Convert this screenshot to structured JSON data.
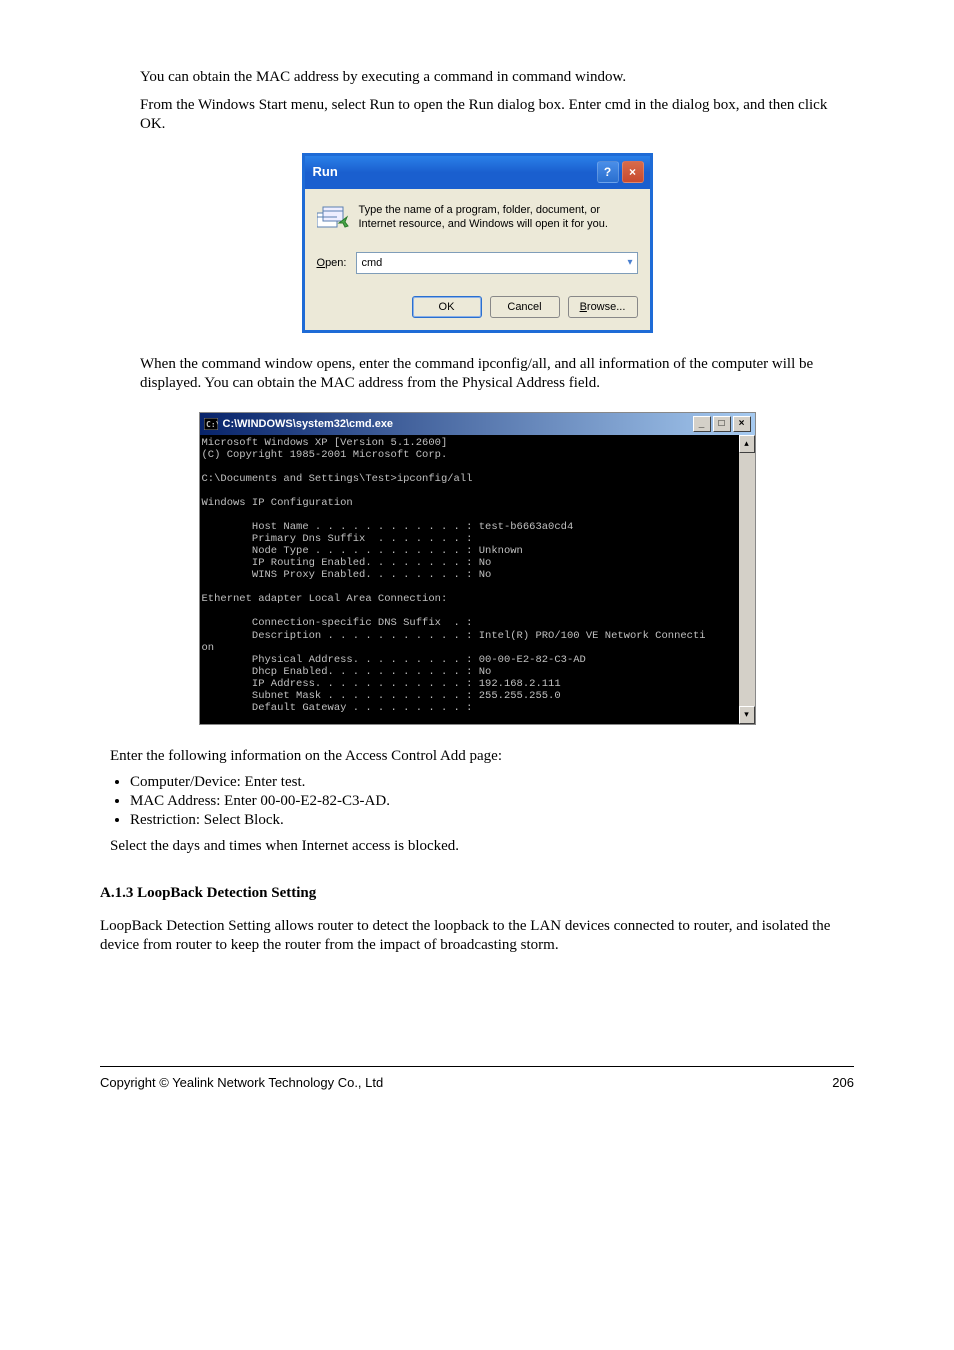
{
  "intro1": "You can obtain the MAC address by executing a command in command window.",
  "intro2": "From the Windows Start menu, select Run to open the Run dialog box. Enter cmd in the dialog box, and then click OK.",
  "run_dialog": {
    "title": "Run",
    "message": "Type the name of a program, folder, document, or Internet resource, and Windows will open it for you.",
    "open_label": "Open:",
    "open_value": "cmd",
    "ok": "OK",
    "cancel": "Cancel",
    "browse": "Browse..."
  },
  "mid_para": "When the command window opens, enter the command ipconfig/all, and all information of the computer will be displayed. You can obtain the MAC address from the Physical Address field.",
  "cmd": {
    "title": "C:\\WINDOWS\\system32\\cmd.exe",
    "output": "Microsoft Windows XP [Version 5.1.2600]\n(C) Copyright 1985-2001 Microsoft Corp.\n\nC:\\Documents and Settings\\Test>ipconfig/all\n\nWindows IP Configuration\n\n        Host Name . . . . . . . . . . . . : test-b6663a0cd4\n        Primary Dns Suffix  . . . . . . . :\n        Node Type . . . . . . . . . . . . : Unknown\n        IP Routing Enabled. . . . . . . . : No\n        WINS Proxy Enabled. . . . . . . . : No\n\nEthernet adapter Local Area Connection:\n\n        Connection-specific DNS Suffix  . :\n        Description . . . . . . . . . . . : Intel(R) PRO/100 VE Network Connecti\non\n        Physical Address. . . . . . . . . : 00-00-E2-82-C3-AD\n        Dhcp Enabled. . . . . . . . . . . : No\n        IP Address. . . . . . . . . . . . : 192.168.2.111\n        Subnet Mask . . . . . . . . . . . : 255.255.255.0\n        Default Gateway . . . . . . . . . :\n\nC:\\Documents and Settings\\Test>"
  },
  "bullets_intro": "Enter the following information on the Access Control Add page:",
  "bullets": [
    "Computer/Device: Enter test.",
    "MAC Address: Enter 00-00-E2-82-C3-AD.",
    "Restriction: Select Block."
  ],
  "trailing": "Select the days and times when Internet access is blocked.",
  "section": "A.1.3 LoopBack Detection Setting",
  "section_para": "LoopBack Detection Setting allows router to detect the loopback to the LAN devices connected to router, and isolated the device from router to keep the router from the impact of broadcasting storm.",
  "footer_left": "Copyright © Yealink Network Technology Co., Ltd",
  "footer_right": "206"
}
